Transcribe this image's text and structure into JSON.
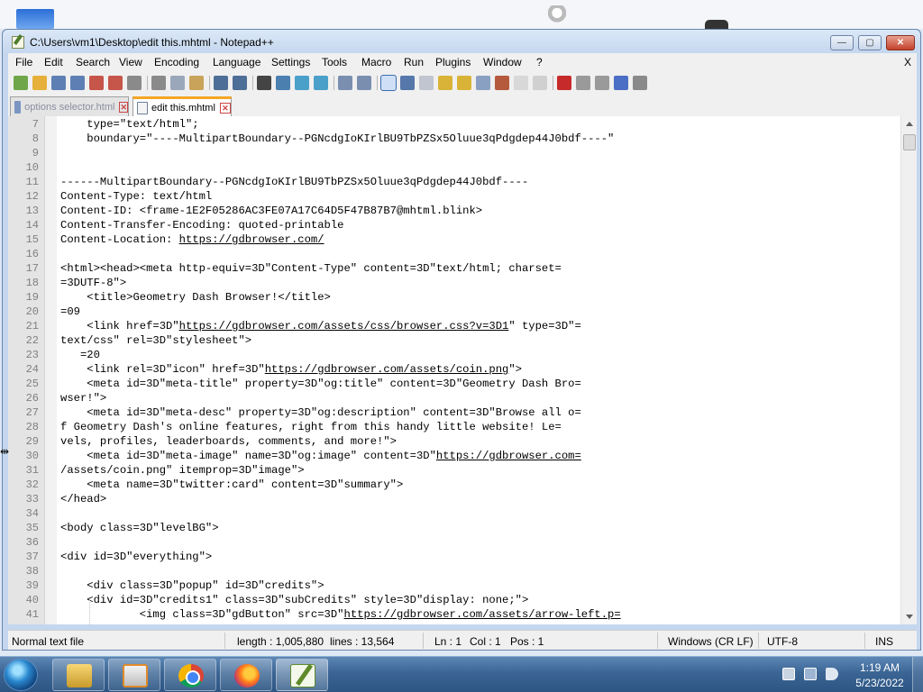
{
  "window": {
    "title": "C:\\Users\\vm1\\Desktop\\edit this.mhtml - Notepad++",
    "min_symbol": "—",
    "max_symbol": "▢",
    "close_symbol": "✕"
  },
  "menu": {
    "items": [
      "File",
      "Edit",
      "Search",
      "View",
      "Encoding",
      "Language",
      "Settings",
      "Tools",
      "Macro",
      "Run",
      "Plugins",
      "Window",
      "?"
    ],
    "close_doc": "X"
  },
  "toolbar": {
    "icons": [
      "new-file-icon",
      "open-file-icon",
      "save-icon",
      "save-all-icon",
      "close-icon",
      "close-all-icon",
      "print-icon",
      "cut-icon",
      "copy-icon",
      "paste-icon",
      "undo-icon",
      "redo-icon",
      "find-icon",
      "replace-icon",
      "zoom-in-icon",
      "zoom-out-icon",
      "sync-vertical-icon",
      "sync-horizontal-icon",
      "word-wrap-icon",
      "show-all-characters-icon",
      "indent-guide-icon",
      "user-defined-language-icon",
      "document-map-icon",
      "document-list-icon",
      "function-list-icon",
      "folder-workspace-icon",
      "monitoring-icon",
      "record-macro-icon",
      "stop-recording-icon",
      "play-macro-icon",
      "run-macro-multiple-icon",
      "save-macro-icon"
    ]
  },
  "tabs": [
    {
      "label": "options selector.html",
      "active": false,
      "close": "✕"
    },
    {
      "label": "edit this.mhtml",
      "active": true,
      "close": "✕"
    }
  ],
  "editor": {
    "lines": [
      {
        "n": "7",
        "text": "    type=\"text/html\";"
      },
      {
        "n": "8",
        "text": "    boundary=\"----MultipartBoundary--PGNcdgIoKIrlBU9TbPZSx5Oluue3qPdgdep44J0bdf----\""
      },
      {
        "n": "9",
        "text": ""
      },
      {
        "n": "10",
        "text": ""
      },
      {
        "n": "11",
        "text": "------MultipartBoundary--PGNcdgIoKIrlBU9TbPZSx5Oluue3qPdgdep44J0bdf----"
      },
      {
        "n": "12",
        "text": "Content-Type: text/html"
      },
      {
        "n": "13",
        "text": "Content-ID: <frame-1E2F05286AC3FE07A17C64D5F47B87B7@mhtml.blink>"
      },
      {
        "n": "14",
        "text": "Content-Transfer-Encoding: quoted-printable"
      },
      {
        "n": "15",
        "text": "Content-Location: ",
        "link": "https://gdbrowser.com/",
        "after": ""
      },
      {
        "n": "16",
        "text": ""
      },
      {
        "n": "17",
        "text": "<html><head><meta http-equiv=3D\"Content-Type\" content=3D\"text/html; charset="
      },
      {
        "n": "18",
        "text": "=3DUTF-8\">"
      },
      {
        "n": "19",
        "text": "    <title>Geometry Dash Browser!</title>"
      },
      {
        "n": "20",
        "text": "=09"
      },
      {
        "n": "21",
        "text": "    <link href=3D\"",
        "link": "https://gdbrowser.com/assets/css/browser.css?v=3D1",
        "after": "\" type=3D\"="
      },
      {
        "n": "22",
        "text": "text/css\" rel=3D\"stylesheet\">"
      },
      {
        "n": "23",
        "text": "   =20"
      },
      {
        "n": "24",
        "text": "    <link rel=3D\"icon\" href=3D\"",
        "link": "https://gdbrowser.com/assets/coin.png",
        "after": "\">"
      },
      {
        "n": "25",
        "text": "    <meta id=3D\"meta-title\" property=3D\"og:title\" content=3D\"Geometry Dash Bro="
      },
      {
        "n": "26",
        "text": "wser!\">"
      },
      {
        "n": "27",
        "text": "    <meta id=3D\"meta-desc\" property=3D\"og:description\" content=3D\"Browse all o="
      },
      {
        "n": "28",
        "text": "f Geometry Dash's online features, right from this handy little website! Le="
      },
      {
        "n": "29",
        "text": "vels, profiles, leaderboards, comments, and more!\">"
      },
      {
        "n": "30",
        "text": "    <meta id=3D\"meta-image\" name=3D\"og:image\" content=3D\"",
        "link": "https://gdbrowser.com=",
        "after": ""
      },
      {
        "n": "31",
        "text": "/assets/coin.png\" itemprop=3D\"image\">"
      },
      {
        "n": "32",
        "text": "    <meta name=3D\"twitter:card\" content=3D\"summary\">"
      },
      {
        "n": "33",
        "text": "</head>"
      },
      {
        "n": "34",
        "text": ""
      },
      {
        "n": "35",
        "text": "<body class=3D\"levelBG\">"
      },
      {
        "n": "36",
        "text": ""
      },
      {
        "n": "37",
        "text": "<div id=3D\"everything\">"
      },
      {
        "n": "38",
        "text": ""
      },
      {
        "n": "39",
        "text": "    <div class=3D\"popup\" id=3D\"credits\">"
      },
      {
        "n": "40",
        "text": "    <div id=3D\"credits1\" class=3D\"subCredits\" style=3D\"display: none;\">"
      },
      {
        "n": "41",
        "text": "            <img class=3D\"gdButton\" src=3D\"",
        "link": "https://gdbrowser.com/assets/arrow-left.p=",
        "after": ""
      }
    ]
  },
  "status": {
    "file_type": "Normal text file",
    "length": "length : 1,005,880",
    "lines": "lines : 13,564",
    "ln": "Ln : 1",
    "col": "Col : 1",
    "pos": "Pos : 1",
    "eol": "Windows (CR LF)",
    "encoding": "UTF-8",
    "mode": "INS"
  },
  "taskbar": {
    "apps": [
      "windows-explorer",
      "windows-media-player",
      "google-chrome",
      "firefox",
      "notepad-plus-plus"
    ],
    "time": "1:19 AM",
    "date": "5/23/2022"
  },
  "colors": {
    "titlebar": "#c3d6ee",
    "active_tab_accent": "#f5a623",
    "taskbar": "#3b6594"
  }
}
